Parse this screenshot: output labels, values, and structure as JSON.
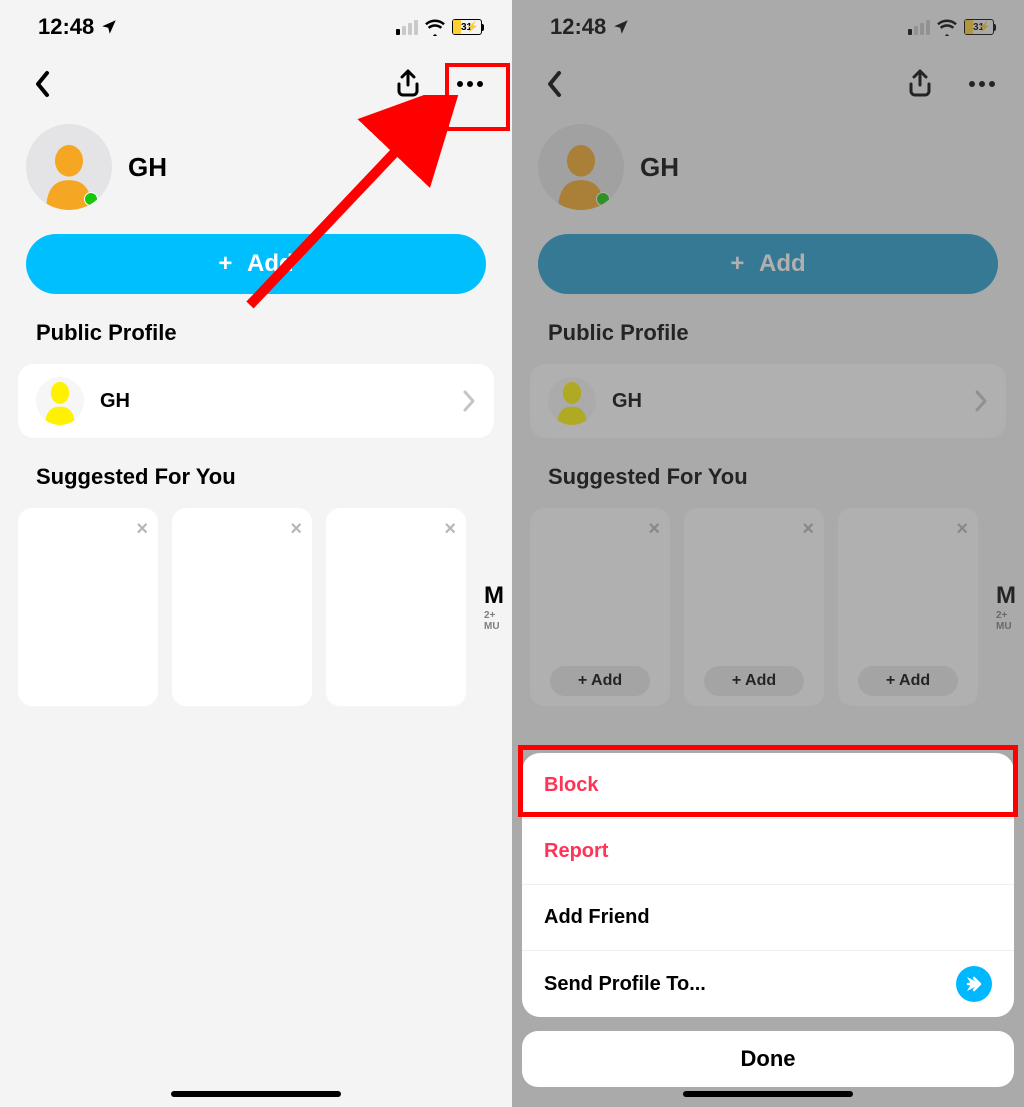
{
  "status": {
    "time": "12:48",
    "battery_percent": "31"
  },
  "profile": {
    "display_name": "GH",
    "add_button_label": "Add",
    "public_profile_title": "Public Profile",
    "public_profile_name": "GH",
    "suggested_title": "Suggested For You",
    "peek_letter": "M",
    "peek_sub": "2+ MU",
    "sugg_add_label": "+ Add"
  },
  "sheet": {
    "block": "Block",
    "report": "Report",
    "add_friend": "Add Friend",
    "send_profile": "Send Profile To...",
    "done": "Done"
  }
}
